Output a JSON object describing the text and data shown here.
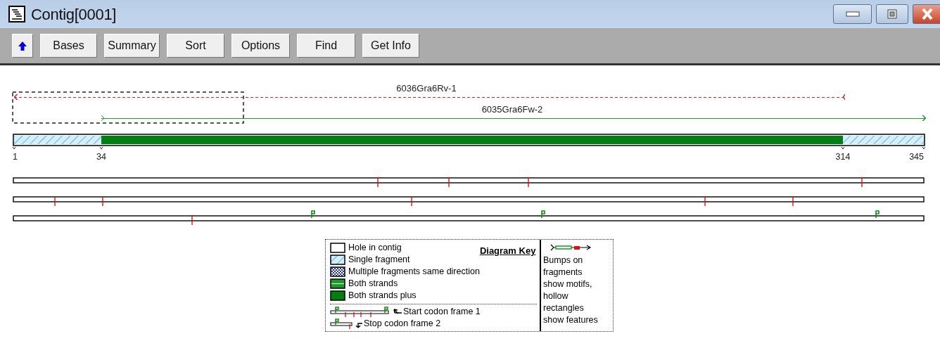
{
  "window": {
    "title": "Contig[0001]"
  },
  "toolbar": [
    {
      "kind": "up"
    },
    {
      "kind": "text",
      "label": "Bases"
    },
    {
      "kind": "text",
      "label": "Summary"
    },
    {
      "kind": "text",
      "label": "Sort"
    },
    {
      "kind": "text",
      "label": "Options"
    },
    {
      "kind": "text",
      "label": "Find"
    },
    {
      "kind": "text",
      "label": "Get Info"
    }
  ],
  "fragments": [
    {
      "name": "6036Gra6Rv-1",
      "reversed": true,
      "color": "#e8202a"
    },
    {
      "name": "6035Gra6Fw-2",
      "reversed": false,
      "color": "#2a9a2a"
    }
  ],
  "coverage": [
    {
      "kind": "single"
    },
    {
      "kind": "both_strands_plus"
    },
    {
      "kind": "single"
    }
  ],
  "ruler": [
    "1",
    "34",
    "314",
    "345"
  ],
  "legend": {
    "title": "Diagram Key",
    "items": [
      {
        "kind": "hole",
        "label": "Hole in contig"
      },
      {
        "kind": "single",
        "label": "Single fragment"
      },
      {
        "kind": "multiple",
        "label": "Multiple fragments same direction"
      },
      {
        "kind": "both_strands",
        "label": "Both strands"
      },
      {
        "kind": "both_strands_plus",
        "label": "Both strands plus"
      }
    ],
    "codons": [
      {
        "kind": "start",
        "label": "Start codon frame 1"
      },
      {
        "kind": "stop",
        "label": "Stop codon frame 2"
      }
    ],
    "note_lines": [
      "Bumps on",
      "fragments",
      "show motifs,",
      "hollow",
      "rectangles",
      "show features"
    ]
  }
}
